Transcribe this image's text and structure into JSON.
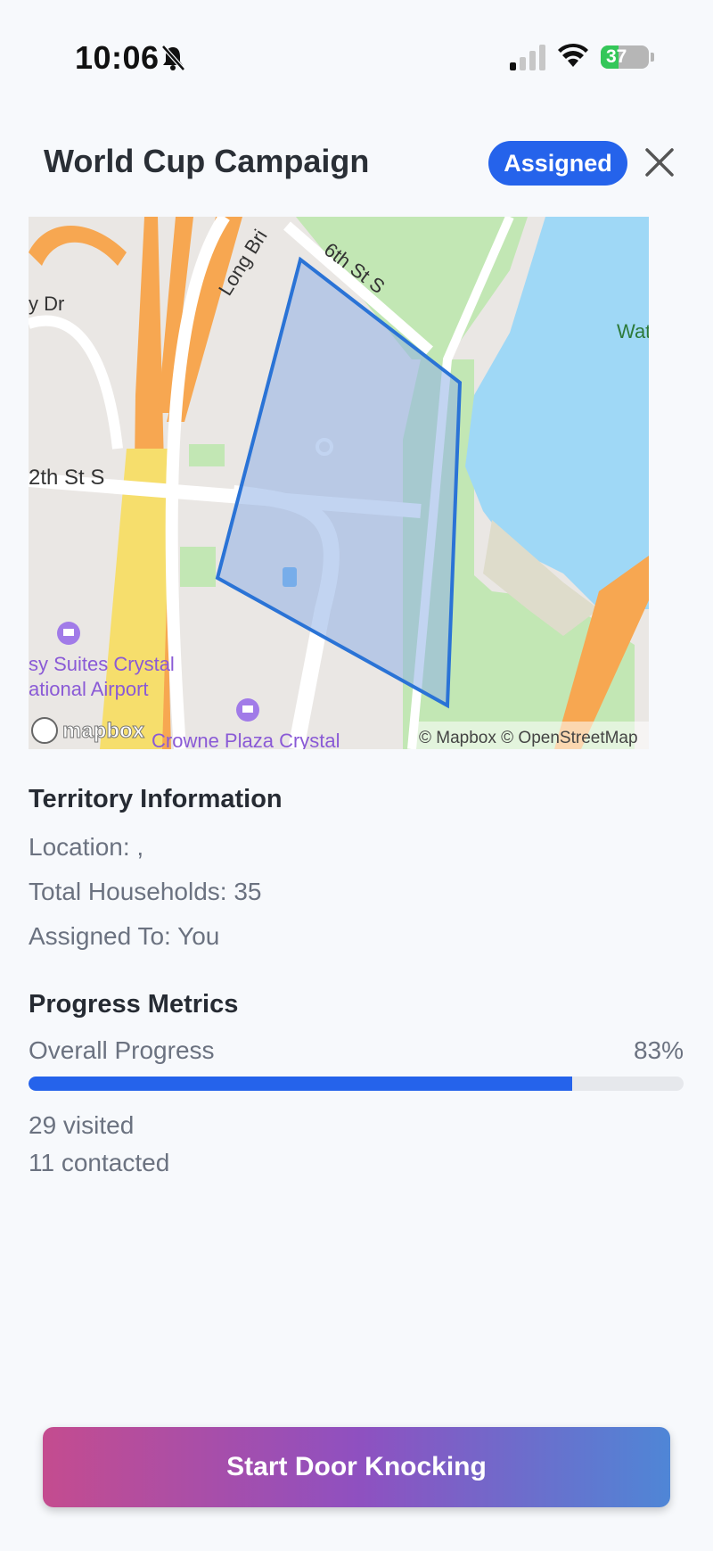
{
  "status_bar": {
    "time": "10:06",
    "battery_level": "37",
    "battery_fraction": 0.37
  },
  "header": {
    "title": "World Cup Campaign",
    "badge": "Assigned",
    "close_icon": "close-icon"
  },
  "map": {
    "labels": {
      "long_bridge": "Long Bri",
      "sixth_st": "6th St S",
      "dr": "y Dr",
      "twelfth_st": "2th St S",
      "water": "Wat",
      "suites_line1": "sy Suites Crystal",
      "suites_line2": "ational Airport",
      "crowne": "Crowne Plaza Crystal",
      "mapbox_logo": "mapbox",
      "attribution": "© Mapbox © OpenStreetMap"
    },
    "colors": {
      "land": "#eae7e4",
      "water": "#9fd8f6",
      "park": "#c2e7b4",
      "highway": "#f7a751",
      "territory_fill": "#8fb0e5",
      "territory_stroke": "#2a73d6"
    }
  },
  "territory": {
    "heading": "Territory Information",
    "location": "Location: ,",
    "households": "Total Households: 35",
    "assigned_to": "Assigned To: You"
  },
  "progress": {
    "heading": "Progress Metrics",
    "label": "Overall Progress",
    "percent_text": "83%",
    "percent": 83,
    "visited": "29 visited",
    "contacted": "11 contacted"
  },
  "cta": {
    "label": "Start Door Knocking"
  }
}
